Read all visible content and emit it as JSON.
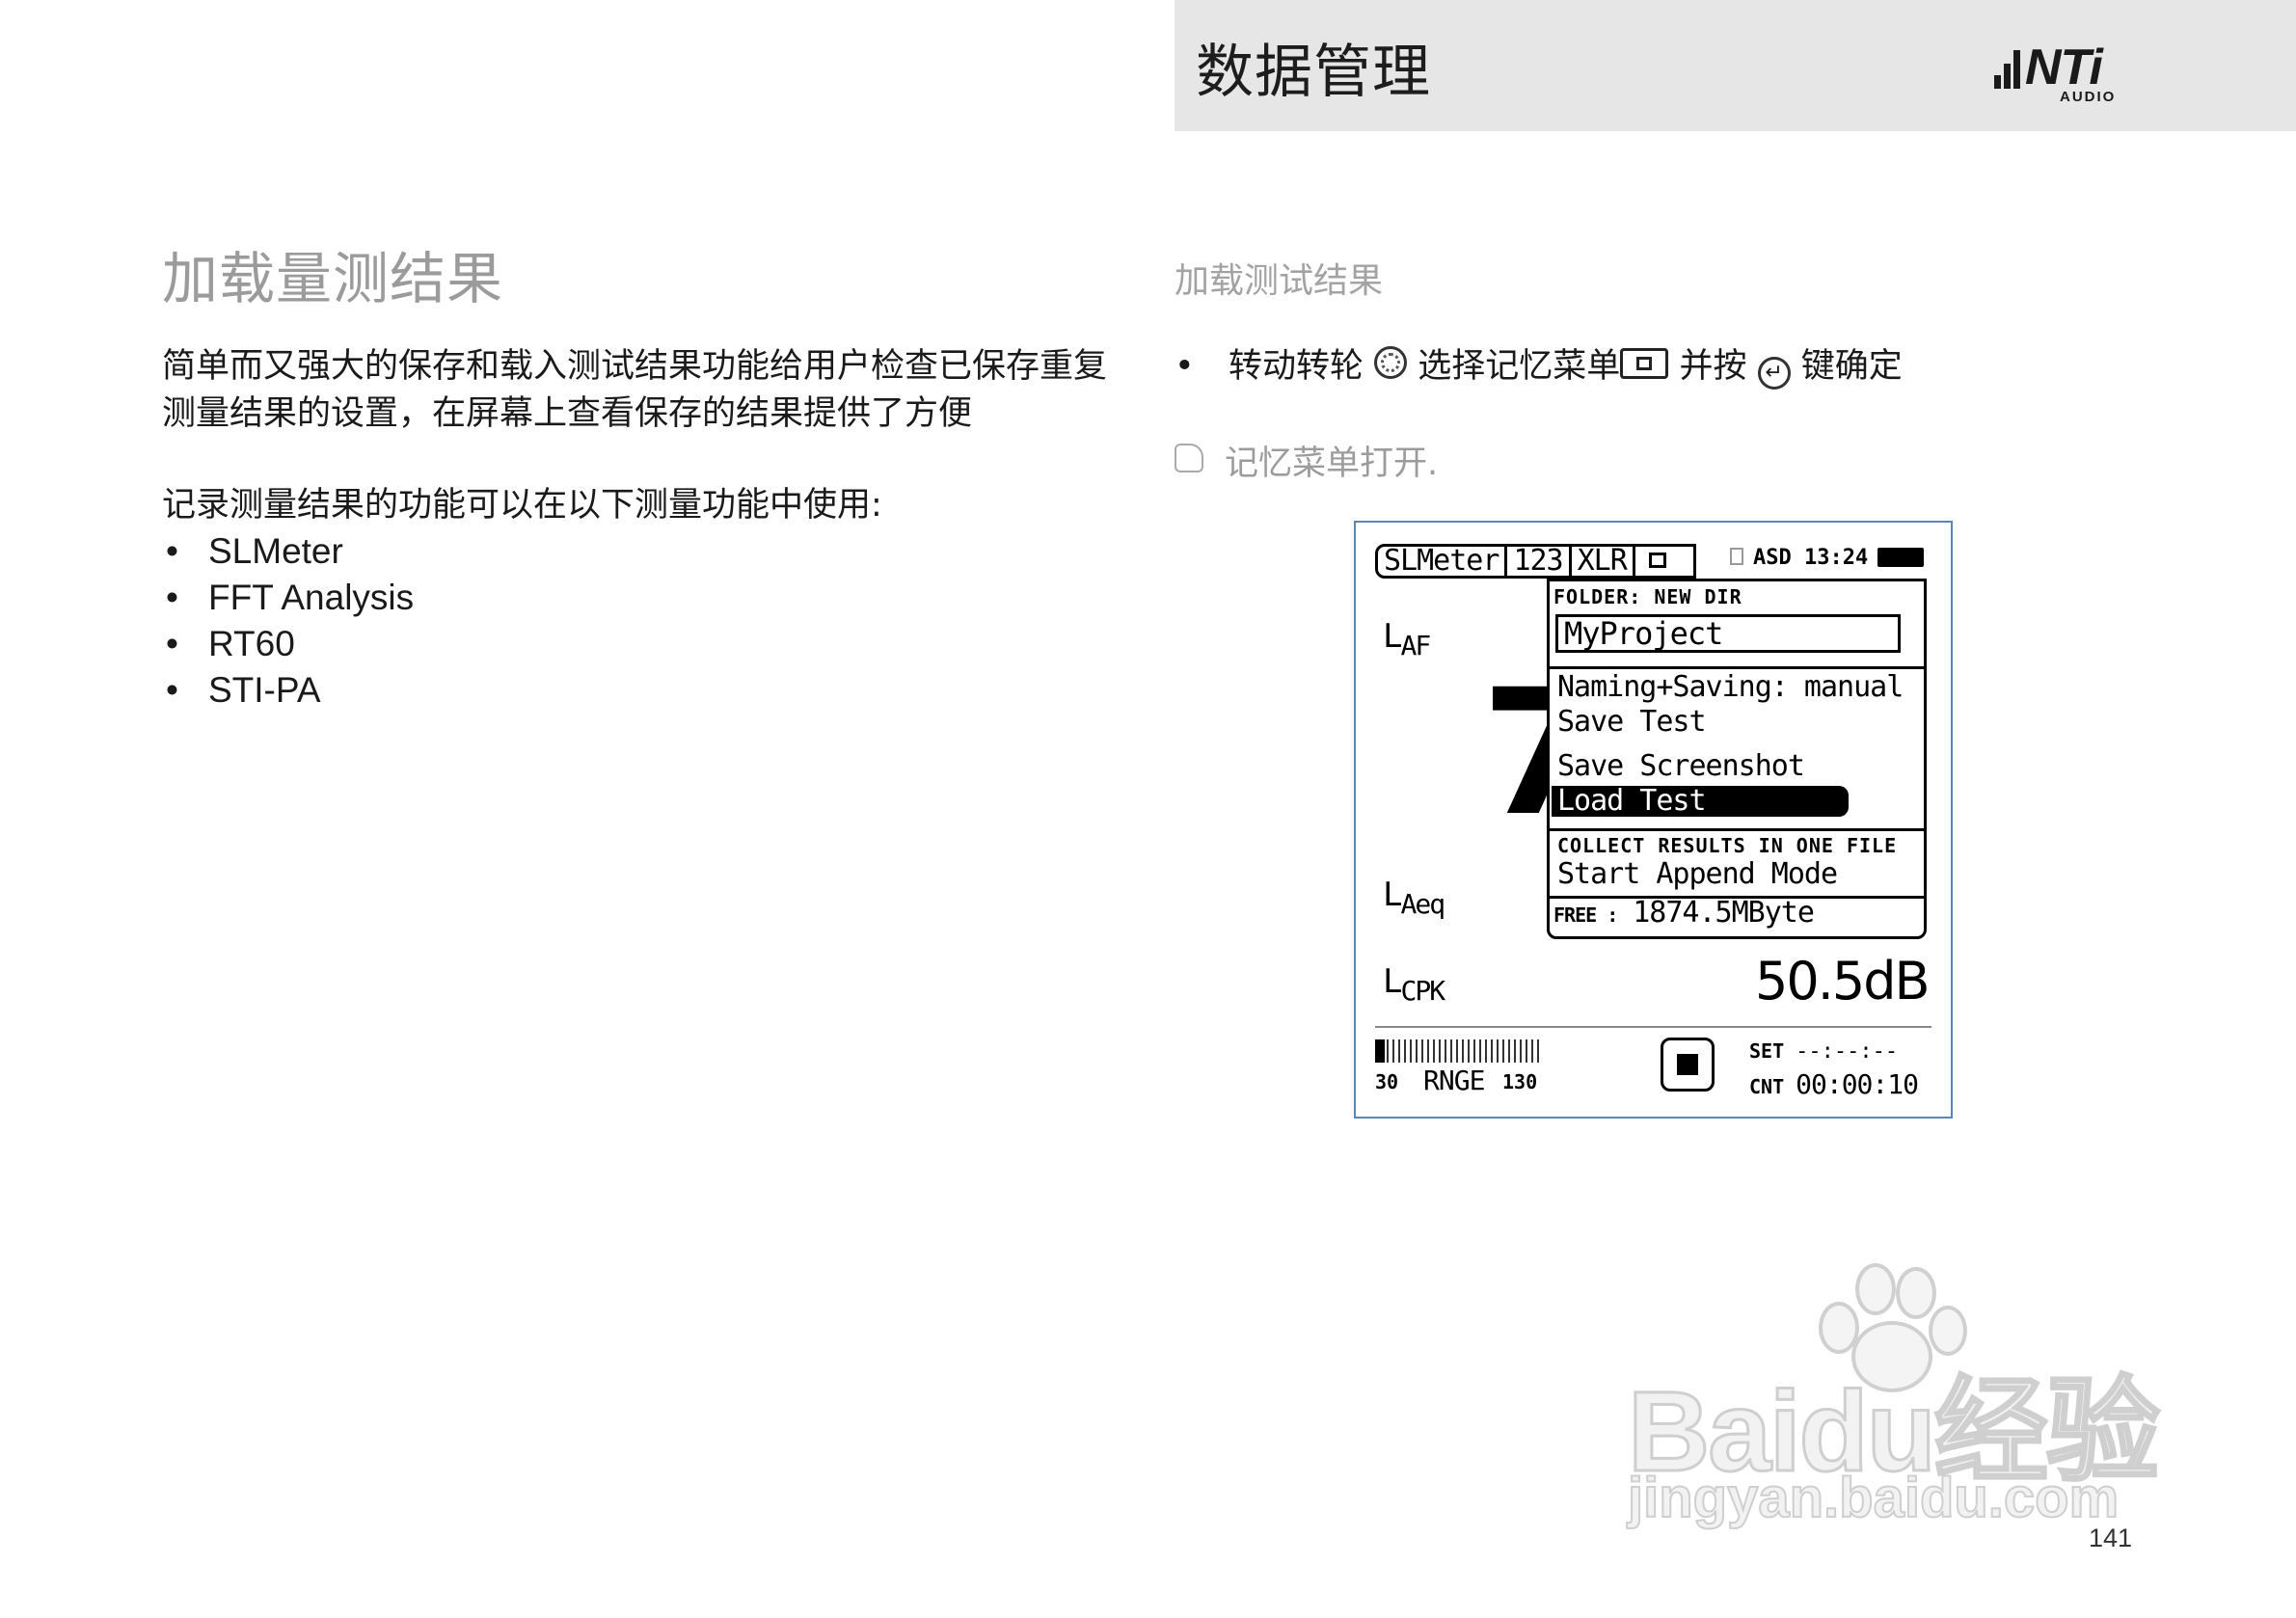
{
  "header": {
    "title": "数据管理",
    "logo_text": "NTi",
    "logo_sub": "AUDIO"
  },
  "left": {
    "heading": "加载量测结果",
    "paragraph1": "简单而又强大的保存和载入测试结果功能给用户检查已保存重复测量结果的设置，在屏幕上查看保存的结果提供了方便",
    "paragraph2": "记录测量结果的功能可以在以下测量功能中使用:",
    "features": [
      "SLMeter",
      "FFT Analysis",
      "RT60",
      "STI-PA"
    ]
  },
  "right": {
    "heading": "加载测试结果",
    "step": {
      "bullet": "•",
      "part1": "转动转轮",
      "part2": "选择记忆菜单",
      "part3": "并按",
      "part4": "键确定"
    },
    "note": "记忆菜单打开."
  },
  "device": {
    "tabs": [
      "SLMeter",
      "123",
      "XLR"
    ],
    "status": "ASD 13:24",
    "label_laf": "L",
    "label_laf_sub": "AF",
    "label_laeq": "L",
    "label_laeq_sub": "Aeq",
    "label_lcpk": "L",
    "label_lcpk_sub": "CPK",
    "big_digit": "7",
    "lcpk_value": "50.5dB",
    "range_low": "30",
    "range_label": "RNGE",
    "range_high": "130",
    "timer_set_label": "SET",
    "timer_set_value": "--:--:--",
    "timer_cnt_label": "CNT",
    "timer_cnt_value": "00:00:10",
    "popup": {
      "folder_label": "FOLDER: NEW DIR",
      "folder_value": "MyProject",
      "naming_saving": "Naming+Saving: manual",
      "save_test": "Save Test",
      "save_screenshot": "Save Screenshot",
      "load_test": "Load Test",
      "collect_label": "COLLECT RESULTS IN ONE FILE",
      "start_append": "Start Append Mode",
      "free_label": "FREE :",
      "free_value": "1874.5MByte"
    }
  },
  "watermark": {
    "brand": "Bai",
    "brand2": "du",
    "brand3": "经验",
    "url": "jingyan.baidu.com"
  },
  "page_number": "141"
}
